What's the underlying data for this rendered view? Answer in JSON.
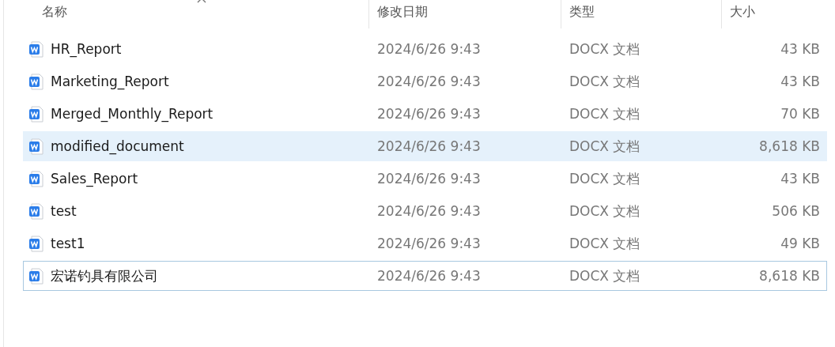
{
  "table": {
    "columns": [
      {
        "label": "名称",
        "sorted": true
      },
      {
        "label": "修改日期",
        "sorted": false
      },
      {
        "label": "类型",
        "sorted": false
      },
      {
        "label": "大小",
        "sorted": false
      }
    ],
    "rows": [
      {
        "name": "HR_Report",
        "modified": "2024/6/26 9:43",
        "type": "DOCX 文档",
        "size": "43 KB",
        "selected": false,
        "focused": false
      },
      {
        "name": "Marketing_Report",
        "modified": "2024/6/26 9:43",
        "type": "DOCX 文档",
        "size": "43 KB",
        "selected": false,
        "focused": false
      },
      {
        "name": "Merged_Monthly_Report",
        "modified": "2024/6/26 9:43",
        "type": "DOCX 文档",
        "size": "70 KB",
        "selected": false,
        "focused": false
      },
      {
        "name": "modified_document",
        "modified": "2024/6/26 9:43",
        "type": "DOCX 文档",
        "size": "8,618 KB",
        "selected": true,
        "focused": false
      },
      {
        "name": "Sales_Report",
        "modified": "2024/6/26 9:43",
        "type": "DOCX 文档",
        "size": "43 KB",
        "selected": false,
        "focused": false
      },
      {
        "name": "test",
        "modified": "2024/6/26 9:43",
        "type": "DOCX 文档",
        "size": "506 KB",
        "selected": false,
        "focused": false
      },
      {
        "name": "test1",
        "modified": "2024/6/26 9:43",
        "type": "DOCX 文档",
        "size": "49 KB",
        "selected": false,
        "focused": false
      },
      {
        "name": "宏诺钓具有限公司",
        "modified": "2024/6/26 9:43",
        "type": "DOCX 文档",
        "size": "8,618 KB",
        "selected": false,
        "focused": true
      }
    ]
  }
}
